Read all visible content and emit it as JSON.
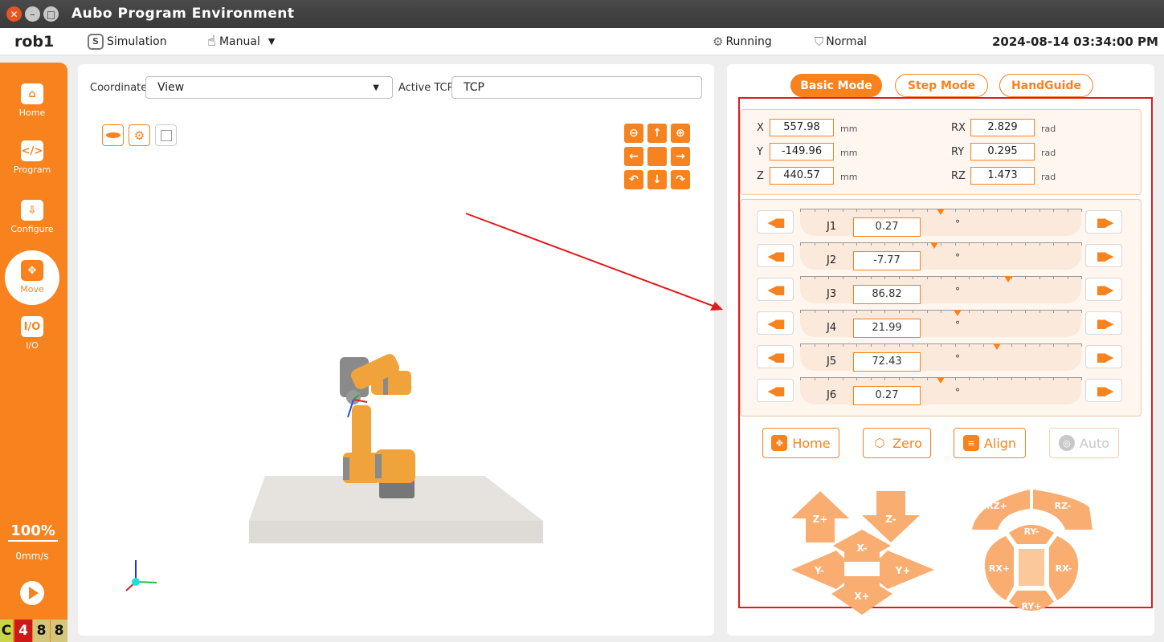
{
  "window": {
    "title": "Aubo Program Environment",
    "colors": {
      "accent": "#f7821e",
      "highlight": "#e01b1b"
    }
  },
  "topbar": {
    "robot": "rob1",
    "mode": "Simulation",
    "control": "Manual",
    "state": "Running",
    "safety": "Normal",
    "datetime": "2024-08-14 03:34:00 PM"
  },
  "sidebar": {
    "items": [
      {
        "label": "Home",
        "icon": "home-icon"
      },
      {
        "label": "Program",
        "icon": "code-icon"
      },
      {
        "label": "Configure",
        "icon": "download-book-icon"
      },
      {
        "label": "Move",
        "icon": "move-arrows-icon"
      },
      {
        "label": "I/O",
        "icon": "io-icon",
        "glyph": "I/O"
      }
    ],
    "speed_percent": "100%",
    "speed_mm": "0mm/s",
    "status_badges": [
      "C",
      "4",
      "8",
      "8"
    ]
  },
  "viewport": {
    "coordinate_label": "Coordinate",
    "coordinate_value": "View",
    "tcp_label": "Active TCP",
    "tcp_value": "TCP"
  },
  "panel": {
    "modes": [
      {
        "label": "Basic Mode",
        "active": true
      },
      {
        "label": "Step Mode",
        "active": false
      },
      {
        "label": "HandGuide",
        "active": false
      }
    ],
    "pose": [
      {
        "axis": "X",
        "value": "557.98",
        "unit": "mm"
      },
      {
        "axis": "Y",
        "value": "-149.96",
        "unit": "mm"
      },
      {
        "axis": "Z",
        "value": "440.57",
        "unit": "mm"
      },
      {
        "axis": "RX",
        "value": "2.829",
        "unit": "rad"
      },
      {
        "axis": "RY",
        "value": "0.295",
        "unit": "rad"
      },
      {
        "axis": "RZ",
        "value": "1.473",
        "unit": "rad"
      }
    ],
    "joints": [
      {
        "name": "J1",
        "value": "0.27",
        "unit": "°",
        "position": 0.5
      },
      {
        "name": "J2",
        "value": "-7.77",
        "unit": "°",
        "position": 0.477
      },
      {
        "name": "J3",
        "value": "86.82",
        "unit": "°",
        "position": 0.741
      },
      {
        "name": "J4",
        "value": "21.99",
        "unit": "°",
        "position": 0.56
      },
      {
        "name": "J5",
        "value": "72.43",
        "unit": "°",
        "position": 0.701
      },
      {
        "name": "J6",
        "value": "0.27",
        "unit": "°",
        "position": 0.5
      }
    ],
    "actions": [
      {
        "label": "Home",
        "enabled": true
      },
      {
        "label": "Zero",
        "enabled": true
      },
      {
        "label": "Align",
        "enabled": true
      },
      {
        "label": "Auto",
        "enabled": false
      }
    ],
    "jog_translate": [
      "Z+",
      "Z-",
      "X-",
      "Y-",
      "Y+",
      "X+"
    ],
    "jog_rotate": [
      "RZ+",
      "RZ-",
      "RY-",
      "RX+",
      "RX-",
      "RY+"
    ]
  }
}
